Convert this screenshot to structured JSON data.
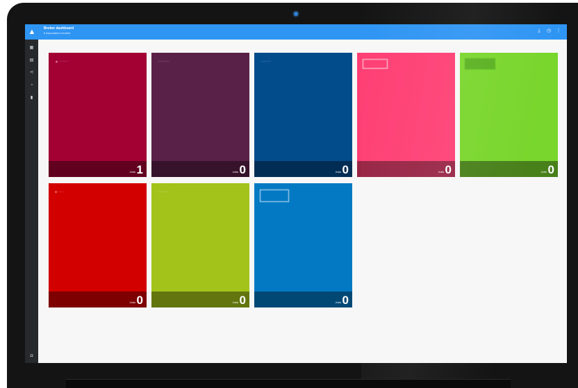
{
  "header": {
    "title": "Broker dashboard",
    "subtitle": "6 Associated Lenders",
    "icons": [
      "download-icon",
      "help-icon",
      "more-icon"
    ]
  },
  "sidebar": {
    "items": [
      {
        "icon": "dashboard-icon",
        "glyph": "▦"
      },
      {
        "icon": "lenders-icon",
        "glyph": "▤"
      },
      {
        "icon": "reports-icon",
        "glyph": "⩤"
      },
      {
        "icon": "time-icon",
        "glyph": "◔"
      },
      {
        "icon": "document-icon",
        "glyph": "▮"
      }
    ],
    "bottom_icon": {
      "icon": "logout-icon",
      "glyph": "◘"
    }
  },
  "jobs_label": "Jobs",
  "tiles": [
    {
      "count": "1",
      "color": "#a30034"
    },
    {
      "count": "0",
      "color": "#5a2148"
    },
    {
      "count": "0",
      "color": "#034c8c"
    },
    {
      "count": "0",
      "color": "#fe3f74"
    },
    {
      "count": "0",
      "color": "#79d62c"
    },
    {
      "count": "0",
      "color": "#d30000"
    },
    {
      "count": "0",
      "color": "#a3c31a"
    },
    {
      "count": "0",
      "color": "#0379c4"
    }
  ],
  "colors": {
    "topbar": "#2f95f3",
    "sidebar": "#262a2d"
  }
}
